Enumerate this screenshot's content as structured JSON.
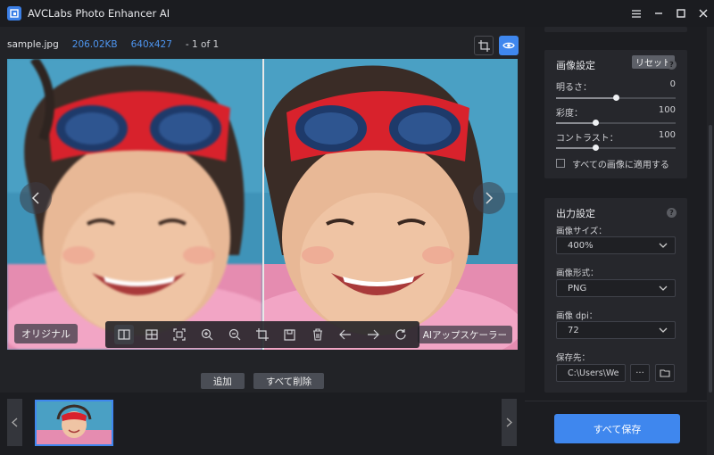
{
  "app": {
    "title": "AVCLabs Photo Enhancer AI",
    "accent": "#3f87ee"
  },
  "window": {
    "controls": [
      "menu-icon",
      "minimize-icon",
      "maximize-icon",
      "close-icon"
    ]
  },
  "file": {
    "name": "sample.jpg",
    "size": "206.02KB",
    "resolution": "640x427",
    "count": "- 1 of 1"
  },
  "viewer": {
    "original_label": "オリジナル",
    "ai_label": "AIアップスケーラー"
  },
  "toolbar": {
    "tools": [
      "split-view-icon",
      "grid-view-icon",
      "fit-screen-icon",
      "zoom-in-icon",
      "zoom-out-icon",
      "crop-icon",
      "save-icon",
      "delete-icon",
      "previous-icon",
      "next-icon",
      "refresh-icon"
    ]
  },
  "actions": {
    "add": "追加",
    "delete_all": "すべて削除"
  },
  "image_settings": {
    "title": "画像設定",
    "reset": "リセット",
    "brightness": {
      "label": "明るさ：",
      "value": "0",
      "level": 0.5
    },
    "saturation": {
      "label": "彩度：",
      "value": "100",
      "level": 0.33
    },
    "contrast": {
      "label": "コントラスト：",
      "value": "100",
      "level": 0.33
    },
    "apply_all": "すべての画像に適用する"
  },
  "output_settings": {
    "title": "出力設定",
    "size_label": "画像サイズ：",
    "size_value": "400%",
    "format_label": "画像形式：",
    "format_value": "PNG",
    "dpi_label": "画像 dpi：",
    "dpi_value": "72",
    "save_to_label": "保存先：",
    "save_to_value": "C:\\Users\\We",
    "more": "···"
  },
  "save_all": "すべて保存"
}
